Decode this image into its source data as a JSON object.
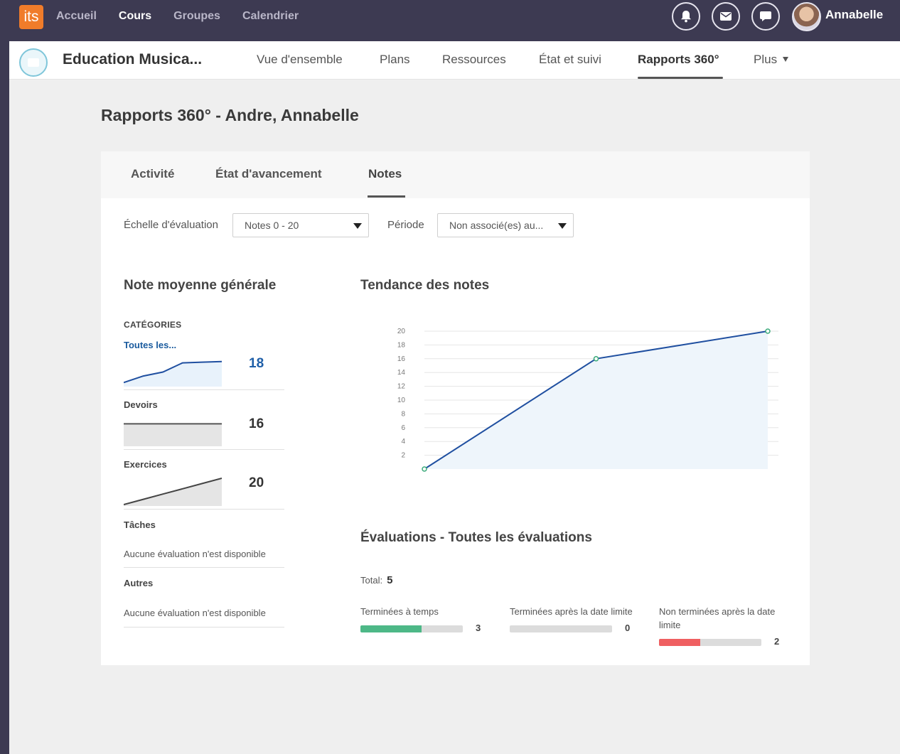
{
  "topbar": {
    "logo": "its",
    "nav": [
      "Accueil",
      "Cours",
      "Groupes",
      "Calendrier"
    ],
    "active_nav": "Cours",
    "icons": [
      "bell-icon",
      "mail-icon",
      "chat-icon"
    ],
    "user": "Annabelle"
  },
  "course": {
    "title": "Education Musica...",
    "nav": [
      "Vue d'ensemble",
      "Plans",
      "Ressources",
      "État et suivi",
      "Rapports 360°",
      "Plus"
    ],
    "active_nav": "Rapports 360°"
  },
  "page": {
    "title": "Rapports 360° - Andre, Annabelle",
    "tabs": [
      "Activité",
      "État d'avancement",
      "Notes"
    ],
    "active_tab": "Notes"
  },
  "filters": {
    "scale_label": "Échelle d'évaluation",
    "scale_value": "Notes 0 - 20",
    "period_label": "Période",
    "period_value": "Non associé(es) au..."
  },
  "average": {
    "title": "Note moyenne générale",
    "categories_head": "CATÉGORIES",
    "items": [
      {
        "name": "Toutes les...",
        "value": "18",
        "trend": [
          2,
          7,
          10,
          17,
          17.5,
          18
        ]
      },
      {
        "name": "Devoirs",
        "value": "16",
        "trend": [
          16,
          16
        ]
      },
      {
        "name": "Exercices",
        "value": "20",
        "trend": [
          0,
          4,
          8,
          12,
          16,
          20
        ]
      },
      {
        "name": "Tâches",
        "message": "Aucune évaluation n'est disponible"
      },
      {
        "name": "Autres",
        "message": "Aucune évaluation n'est disponible"
      }
    ]
  },
  "trend": {
    "title": "Tendance des notes",
    "chart_data": {
      "type": "area",
      "series": [
        {
          "values": [
            0,
            16,
            20
          ]
        }
      ],
      "ylim": [
        0,
        20
      ],
      "yticks": [
        2,
        4,
        6,
        8,
        10,
        12,
        14,
        16,
        18,
        20
      ],
      "colors": {
        "line": "#1f4fa0",
        "fill": "#eef5fb",
        "points": "#3aaa7a"
      }
    }
  },
  "evaluations": {
    "title": "Évaluations - Toutes les évaluations",
    "total_label": "Total:",
    "total": "5",
    "groups": [
      {
        "label": "Terminées à temps",
        "count": "3",
        "fraction": 0.6,
        "color": "#4db887"
      },
      {
        "label": "Terminées après la date limite",
        "count": "0",
        "fraction": 0,
        "color": "#4db887"
      },
      {
        "label": "Non terminées après la date limite",
        "count": "2",
        "fraction": 0.4,
        "color": "#ef5f61"
      }
    ]
  }
}
